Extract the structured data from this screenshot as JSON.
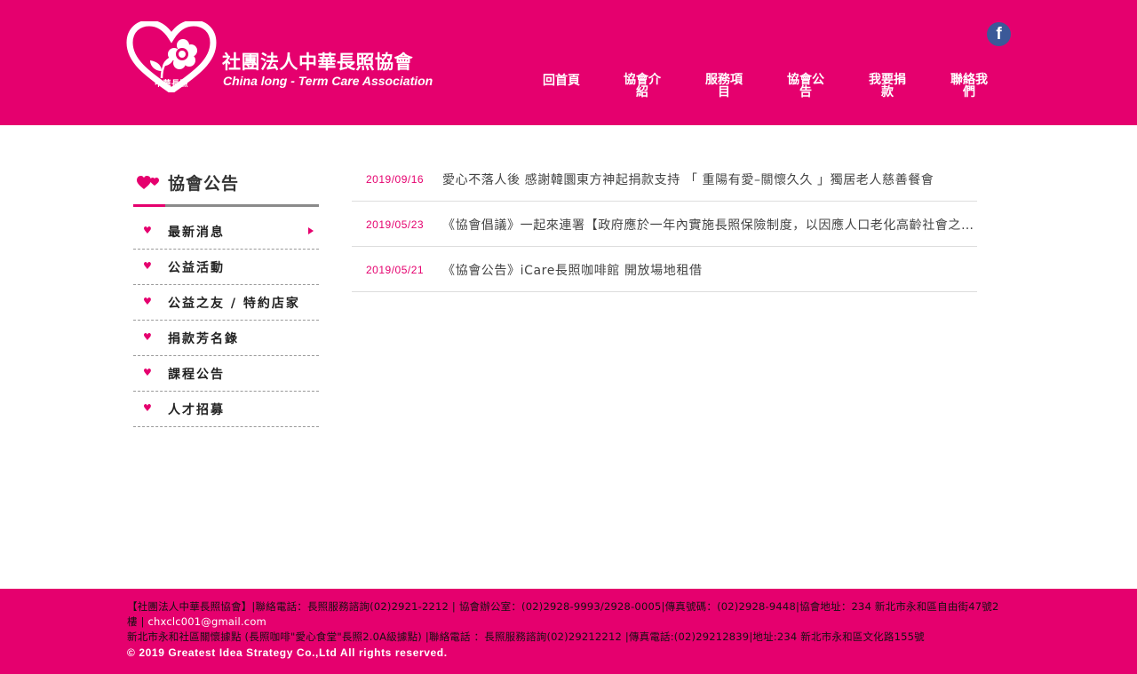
{
  "colors": {
    "brand": "#e5006e",
    "facebook": "#3b5998",
    "text": "#444444"
  },
  "header": {
    "logo_mark_text": "中華長照",
    "logo_zh": "社團法人中華長照協會",
    "logo_en": "China long - Term Care Association",
    "facebook_icon": "f",
    "nav": [
      {
        "label": "回首頁"
      },
      {
        "label": "協會介紹"
      },
      {
        "label": "服務項目"
      },
      {
        "label": "協會公告"
      },
      {
        "label": "我要捐款"
      },
      {
        "label": "聯絡我們"
      }
    ]
  },
  "sidebar": {
    "title": "協會公告",
    "bullet_icon": "heart-icon",
    "items": [
      {
        "label": "最新消息",
        "active": true
      },
      {
        "label": "公益活動"
      },
      {
        "label": "公益之友 / 特約店家"
      },
      {
        "label": "捐款芳名錄"
      },
      {
        "label": "課程公告"
      },
      {
        "label": "人才招募"
      }
    ]
  },
  "news": [
    {
      "date": "2019/09/16",
      "title": "愛心不落人後 感謝韓圜東方神起捐款支持 「 重陽有愛–關懷久久 」獨居老人慈善餐會"
    },
    {
      "date": "2019/05/23",
      "title": "《協會倡議》一起來連署【政府應於一年內實施長照保險制度，以因應人口老化高齡社會之長期照顧需求】"
    },
    {
      "date": "2019/05/21",
      "title": "《協會公告》iCare長照咖啡館 開放場地租借"
    }
  ],
  "footer": {
    "line1": "【社團法人中華長照協會】|聯絡電話：長照服務諮詢(02)2921-2212 | 協會辦公室：(02)2928-9993/2928-0005|傳真號碼：(02)2928-9448|協會地址：234 新北市永和區自由街47號2樓",
    "email_prefix": " |",
    "email": "chxclc001@gmail.com",
    "line2": "新北市永和社區關懷據點 (長照咖啡\"愛心食堂\"長照2.0A級據點) |聯絡電話 ：長照服務諮詢(02)29212212 |傳真電話:(02)29212839|地址:234 新北市永和區文化路155號",
    "copyright": "© 2019 Greatest Idea Strategy Co.,Ltd All rights reserved."
  }
}
